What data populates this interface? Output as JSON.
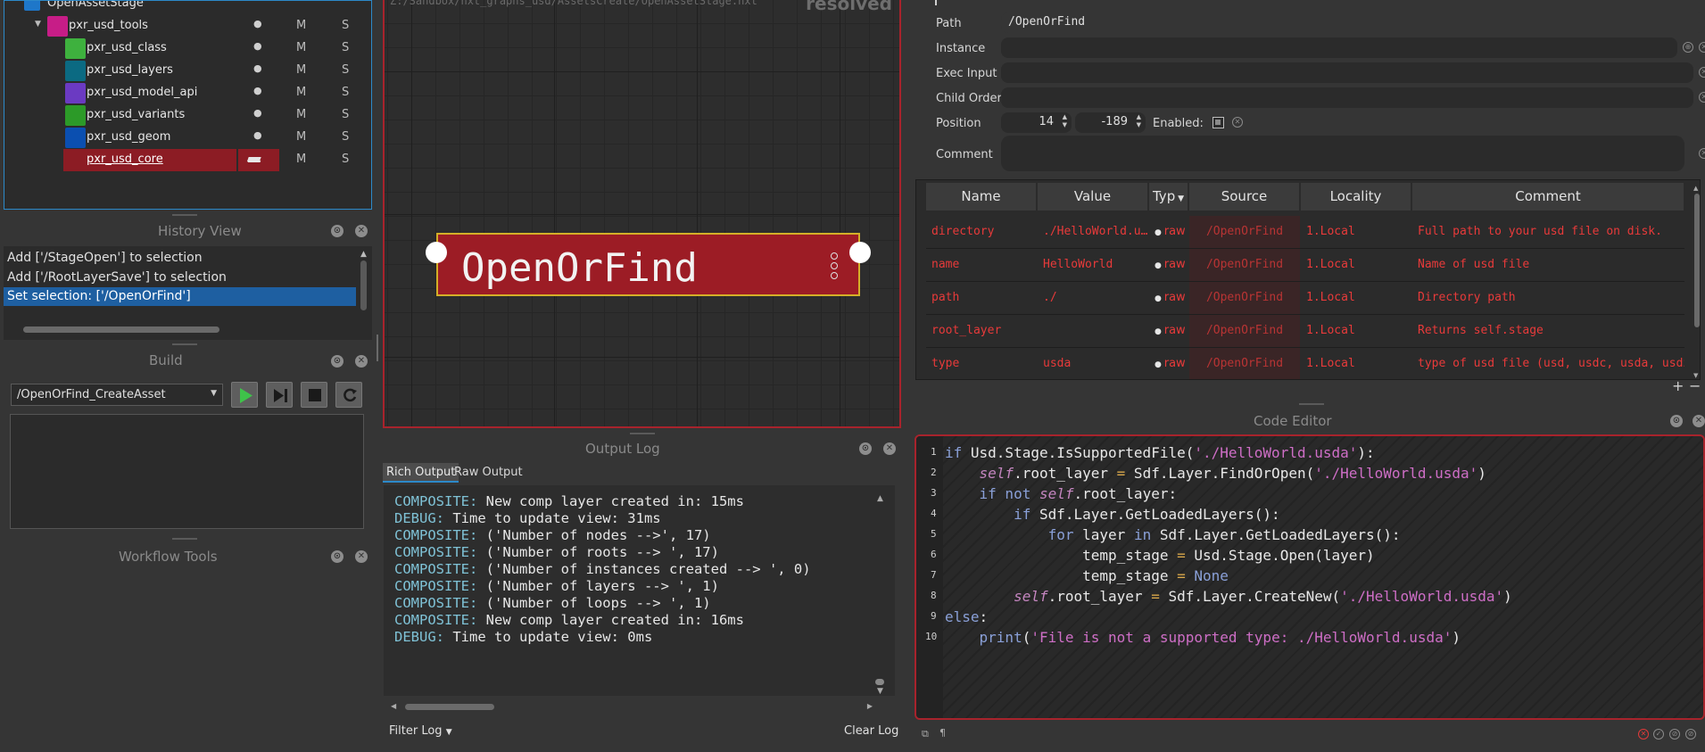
{
  "outliner": {
    "root_label": "OpenAssetStage",
    "items": [
      {
        "label": "pxr_usd_tools",
        "color": "#c71d87",
        "m": "M",
        "s": "S",
        "dot": "●"
      },
      {
        "label": "pxr_usd_class",
        "color": "#3eb13e",
        "m": "M",
        "s": "S",
        "dot": "●"
      },
      {
        "label": "pxr_usd_layers",
        "color": "#0b6a82",
        "m": "M",
        "s": "S",
        "dot": "●"
      },
      {
        "label": "pxr_usd_model_api",
        "color": "#6b3ac2",
        "m": "M",
        "s": "S",
        "dot": "●"
      },
      {
        "label": "pxr_usd_variants",
        "color": "#2c9a28",
        "m": "M",
        "s": "S",
        "dot": "●"
      },
      {
        "label": "pxr_usd_geom",
        "color": "#0b4fb0",
        "m": "M",
        "s": "S",
        "dot": "●"
      },
      {
        "label": "pxr_usd_core",
        "color": "#8c1c24",
        "m": "M",
        "s": "S",
        "dot": ""
      }
    ]
  },
  "history": {
    "title": "History View",
    "items": [
      "Add ['/StageOpen'] to selection",
      "Add ['/RootLayerSave'] to selection",
      "Set selection: ['/OpenOrFind']"
    ]
  },
  "build": {
    "title": "Build",
    "target": "/OpenOrFind_CreateAsset"
  },
  "workflow": {
    "title": "Workflow Tools"
  },
  "graph": {
    "path_text": "Z:/Sandbox/nxt_graphs_usd/AssetsCreate/OpenAssetStage.nxt",
    "mode_text": "resolved",
    "node_title": "OpenOrFind"
  },
  "output_log": {
    "title": "Output Log",
    "tabs": [
      "Rich Output",
      "Raw Output"
    ],
    "lines": [
      {
        "prefix": "COMPOSITE:",
        "text": " New comp layer created in: 15ms"
      },
      {
        "prefix": "DEBUG:",
        "text": " Time to update view: 31ms"
      },
      {
        "prefix": "COMPOSITE:",
        "text": " ('Number of nodes -->', 17)"
      },
      {
        "prefix": "COMPOSITE:",
        "text": " ('Number of roots --> ', 17)"
      },
      {
        "prefix": "COMPOSITE:",
        "text": " ('Number of instances created --> ', 0)"
      },
      {
        "prefix": "COMPOSITE:",
        "text": " ('Number of layers --> ', 1)"
      },
      {
        "prefix": "COMPOSITE:",
        "text": " ('Number of loops --> ', 1)"
      },
      {
        "prefix": "COMPOSITE:",
        "text": " New comp layer created in: 16ms"
      },
      {
        "prefix": "DEBUG:",
        "text": " Time to update view: 0ms"
      }
    ],
    "filter_label": "Filter Log",
    "clear_label": "Clear Log"
  },
  "properties": {
    "path_label": "Path",
    "path_value": "/OpenOrFind",
    "instance_label": "Instance",
    "exec_label": "Exec Input",
    "child_label": "Child Order",
    "position_label": "Position",
    "pos_x": "14",
    "pos_y": "-189",
    "enabled_label": "Enabled:",
    "comment_label": "Comment"
  },
  "attr_table": {
    "headers": [
      "Name",
      "Value",
      "Typ",
      "Source",
      "Locality",
      "Comment"
    ],
    "rows": [
      {
        "name": "directory",
        "value": "./HelloWorld.u…",
        "type": "raw",
        "source": "/OpenOrFind",
        "locality": "1.Local",
        "comment": "Full path to your usd file on disk."
      },
      {
        "name": "name",
        "value": "HelloWorld",
        "type": "raw",
        "source": "/OpenOrFind",
        "locality": "1.Local",
        "comment": "Name of usd file"
      },
      {
        "name": "path",
        "value": "./",
        "type": "raw",
        "source": "/OpenOrFind",
        "locality": "1.Local",
        "comment": "Directory path"
      },
      {
        "name": "root_layer",
        "value": "",
        "type": "raw",
        "source": "/OpenOrFind",
        "locality": "1.Local",
        "comment": "Returns self.stage"
      },
      {
        "name": "type",
        "value": "usda",
        "type": "raw",
        "source": "/OpenOrFind",
        "locality": "1.Local",
        "comment": "type of usd file (usd, usdc, usda, usdz)"
      }
    ],
    "add_label": "+",
    "remove_label": "−"
  },
  "code_editor": {
    "title": "Code Editor",
    "line_numbers": [
      "1",
      "2",
      "3",
      "4",
      "5",
      "6",
      "7",
      "8",
      "9",
      "10"
    ]
  }
}
